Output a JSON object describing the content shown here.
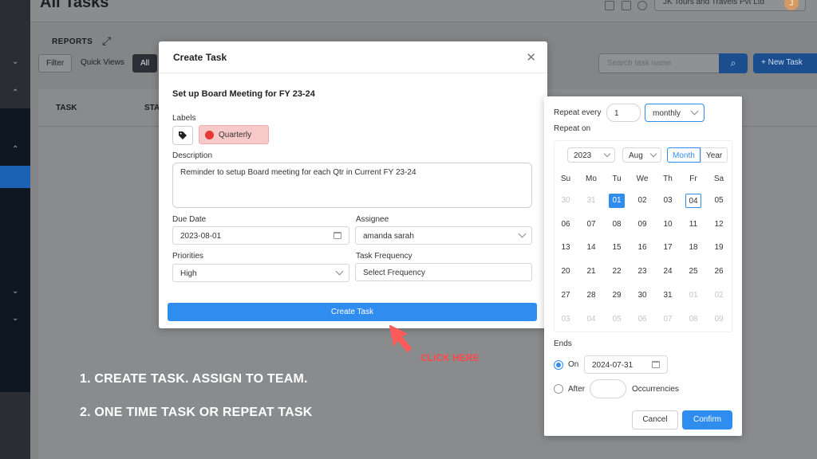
{
  "app": {
    "page_title": "All Tasks",
    "company": "JK Tours and Travels Pvt Ltd",
    "avatar_initial": "J",
    "reports_label": "REPORTS",
    "filter_label": "Filter",
    "quick_views_label": "Quick Views",
    "all_label": "All",
    "search_placeholder": "Search task name",
    "new_task_label": "New Task",
    "col_task": "TASK",
    "col_status_partial": "STA"
  },
  "modal": {
    "title": "Create Task",
    "task_name": "Set up Board Meeting for FY 23-24",
    "labels_label": "Labels",
    "label_chip": "Quarterly",
    "description_label": "Description",
    "description_value": "Reminder to setup Board meeting for each Qtr in Current FY 23-24",
    "due_date_label": "Due Date",
    "due_date_value": "2023-08-01",
    "assignee_label": "Assignee",
    "assignee_value": "amanda sarah",
    "priorities_label": "Priorities",
    "priority_value": "High",
    "task_frequency_label": "Task Frequency",
    "task_frequency_value": "Select Frequency",
    "create_button": "Create Task"
  },
  "repeat": {
    "repeat_every_label": "Repeat every",
    "repeat_every_value": "1",
    "repeat_unit": "monthly",
    "repeat_on_label": "Repeat on",
    "year": "2023",
    "month": "Aug",
    "view_month": "Month",
    "view_year": "Year",
    "weekdays": [
      "Su",
      "Mo",
      "Tu",
      "We",
      "Th",
      "Fr",
      "Sa"
    ],
    "weeks": [
      [
        "30",
        "31",
        "01",
        "02",
        "03",
        "04",
        "05"
      ],
      [
        "06",
        "07",
        "08",
        "09",
        "10",
        "11",
        "12"
      ],
      [
        "13",
        "14",
        "15",
        "16",
        "17",
        "18",
        "19"
      ],
      [
        "20",
        "21",
        "22",
        "23",
        "24",
        "25",
        "26"
      ],
      [
        "27",
        "28",
        "29",
        "30",
        "31",
        "01",
        "02"
      ],
      [
        "03",
        "04",
        "05",
        "06",
        "07",
        "08",
        "09"
      ]
    ],
    "selected_day": "01",
    "today_day": "04",
    "ends_label": "Ends",
    "on_label": "On",
    "end_date": "2024-07-31",
    "after_label": "After",
    "occurrences_label": "Occurrencies",
    "cancel_label": "Cancel",
    "confirm_label": "Confirm"
  },
  "annotations": {
    "click_here": "CLICK HERE",
    "note1": "1. CREATE TASK. ASSIGN TO TEAM.",
    "note2": "2. ONE TIME TASK OR REPEAT TASK"
  },
  "colors": {
    "accent": "#2f8df0",
    "chip_bg": "#f7c9c9",
    "chip_dot": "#e53935",
    "annotation_red": "#ff4a4a"
  }
}
